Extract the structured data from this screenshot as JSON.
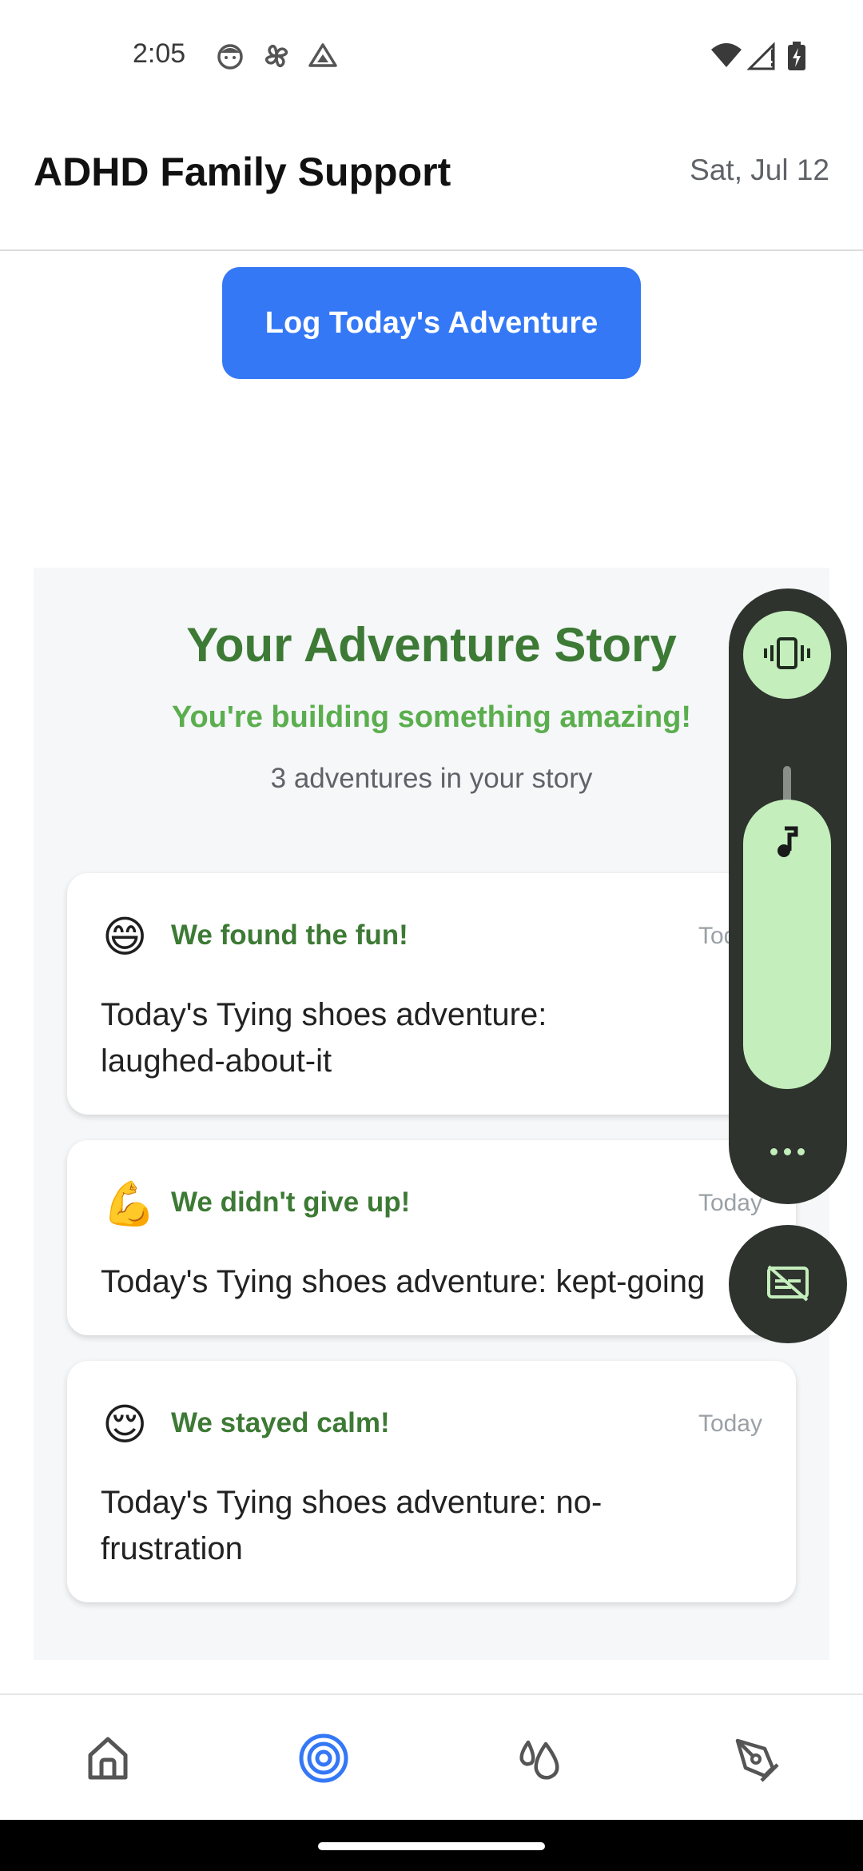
{
  "status_bar": {
    "time": "2:05",
    "icons": [
      "face-icon",
      "pinwheel-icon",
      "drive-icon",
      "wifi-icon",
      "signal-icon",
      "battery-charging-icon"
    ]
  },
  "header": {
    "title": "ADHD Family Support",
    "date": "Sat, Jul 12"
  },
  "actions": {
    "log_button": "Log Today's Adventure"
  },
  "story": {
    "title": "Your Adventure Story",
    "subtitle": "You're building something amazing!",
    "count": "3 adventures in your story",
    "entries": [
      {
        "emoji": "😄",
        "title": "We found the fun!",
        "date": "Today",
        "text": "Today's Tying shoes adventure: laughed-about-it"
      },
      {
        "emoji": "💪",
        "title": "We didn't give up!",
        "date": "Today",
        "text": "Today's Tying shoes adventure: kept-going"
      },
      {
        "emoji": "😌",
        "title": "We stayed calm!",
        "date": "Today",
        "text": "Today's Tying shoes adventure: no-frustration"
      }
    ]
  },
  "volume_panel": {
    "icons": [
      "vibrate-icon",
      "music-note-icon",
      "more-icon",
      "captions-off-icon"
    ],
    "level": 1.0
  },
  "bottom_nav": {
    "items": [
      "home-icon",
      "target-icon",
      "drops-icon",
      "pen-tool-icon"
    ],
    "active_index": 1
  },
  "colors": {
    "accent_blue": "#3478f6",
    "green_title": "#3d7a35",
    "green_subtitle": "#5bae4e",
    "panel_dark": "#2e332e",
    "panel_light": "#c4eebc"
  }
}
